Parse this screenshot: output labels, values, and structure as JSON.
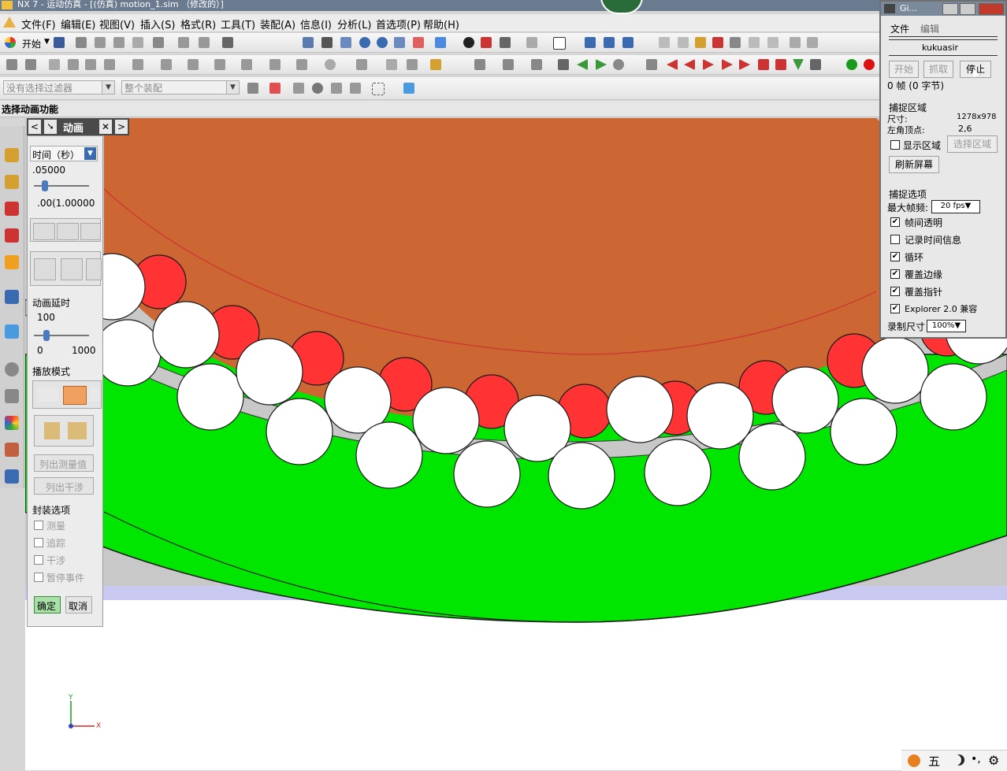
{
  "window": {
    "title": "NX 7 - 运动仿真 - [(仿真) motion_1.sim （修改的）]"
  },
  "menubar": {
    "items": [
      "文件(F)",
      "编辑(E)",
      "视图(V)",
      "插入(S)",
      "格式(R)",
      "工具(T)",
      "装配(A)",
      "信息(I)",
      "分析(L)",
      "首选项(P)",
      "帮助(H)"
    ]
  },
  "toolbar1": {
    "start_label": "开始"
  },
  "filters": {
    "selection_filter": "没有选择过滤器",
    "assembly_scope": "整个装配"
  },
  "statusline": {
    "prompt": "选择动画功能"
  },
  "panel": {
    "tab_title": "动画",
    "time_label": "时间（秒）",
    "time_value": ".05000",
    "time_range": ".00(1.00000",
    "delay_label": "动画延时",
    "delay_value": "100",
    "delay_min": "0",
    "delay_max": "1000",
    "playback_label": "播放模式",
    "list_measure_label": "列出测量值",
    "list_interference_label": "列出干涉",
    "envelope_label": "封装选项",
    "options": [
      "测量",
      "追踪",
      "干涉",
      "暂停事件"
    ],
    "ok_label": "确定",
    "cancel_label": "取消"
  },
  "capture": {
    "title": "Gi...",
    "menu_file": "文件",
    "menu_edit": "编辑",
    "author": "kukuasir",
    "start_label": "开始",
    "grab_label": "抓取",
    "stop_label": "停止",
    "frame_info": "0 帧 (0 字节)",
    "region_section": "捕捉区域",
    "size_label": "尺寸:",
    "size_value": "1278x978",
    "corner_label": "左角顶点:",
    "corner_value": "2,6",
    "show_region_label": "显示区域",
    "select_region_label": "选择区域",
    "refresh_label": "刷新屏幕",
    "options_section": "捕捉选项",
    "max_fps_label": "最大帧频:",
    "max_fps_value": "20 fps",
    "options": [
      {
        "label": "帧间透明",
        "checked": true
      },
      {
        "label": "记录时间信息",
        "checked": false
      },
      {
        "label": "循环",
        "checked": true
      },
      {
        "label": "覆盖边缘",
        "checked": true
      },
      {
        "label": "覆盖指针",
        "checked": true
      },
      {
        "label": "Explorer 2.0 兼容",
        "checked": true
      }
    ],
    "record_size_label": "录制尺寸",
    "record_size_value": "100%"
  },
  "axes": {
    "y": "Y",
    "x": "X"
  },
  "tray": {
    "ime": "五"
  },
  "colors": {
    "gear_brown": "#cc6633",
    "ring_green": "#00e600",
    "ball_red": "#ff3333",
    "ball_white": "#ffffff",
    "cage_gray": "#c8c8c8",
    "band_lavender": "#c8c8f0"
  }
}
